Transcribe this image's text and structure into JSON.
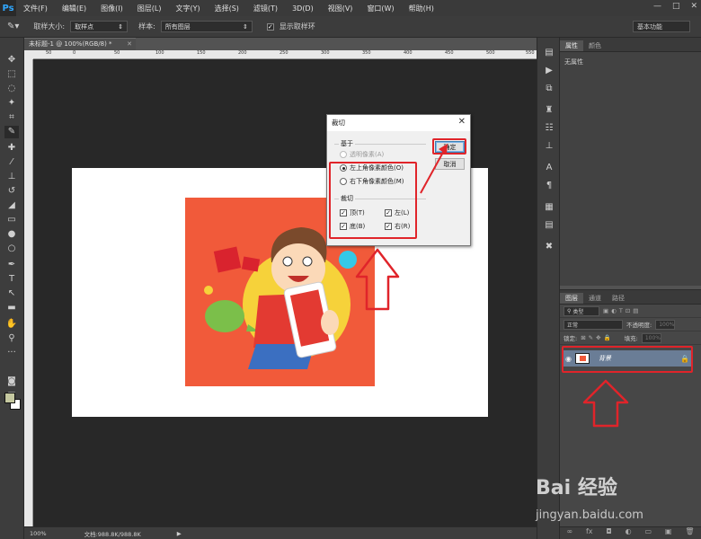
{
  "app": {
    "logo": "Ps",
    "menu": [
      "文件(F)",
      "编辑(E)",
      "图像(I)",
      "图层(L)",
      "文字(Y)",
      "选择(S)",
      "滤镜(T)",
      "3D(D)",
      "视图(V)",
      "窗口(W)",
      "帮助(H)"
    ],
    "window_controls": [
      "—",
      "□",
      "✕"
    ]
  },
  "options_bar": {
    "sample_size_label": "取样大小:",
    "sample_size_value": "取样点",
    "sample_label": "样本:",
    "sample_value": "所有图层",
    "show_ring_label": "显示取样环",
    "workspace": "基本功能"
  },
  "document": {
    "tab_title": "未标题-1 @ 100%(RGB/8) *",
    "ruler_top": [
      "50",
      "0",
      "50",
      "100",
      "150",
      "200",
      "250",
      "300",
      "350",
      "400",
      "450",
      "500",
      "550"
    ],
    "status_zoom": "100%",
    "status_doc": "文档:988.8K/988.8K"
  },
  "dialog": {
    "title": "裁切",
    "based_on_label": "基于",
    "opt_transparent": "透明像素(A)",
    "opt_top_left": "左上角像素颜色(O)",
    "opt_bottom_right": "右下角像素颜色(M)",
    "trim_label": "裁切",
    "chk_top": "顶(T)",
    "chk_left": "左(L)",
    "chk_bottom": "底(B)",
    "chk_right": "右(R)",
    "ok_button": "确定",
    "cancel_button": "取消"
  },
  "properties_panel": {
    "tabs": [
      "属性",
      "颜色"
    ],
    "content": "无属性"
  },
  "layers_panel": {
    "tabs": [
      "图层",
      "通道",
      "路径"
    ],
    "filter_kind": "类型",
    "blend_mode": "正常",
    "opacity_label": "不透明度:",
    "opacity_value": "100%",
    "lock_label": "锁定:",
    "fill_label": "填充:",
    "fill_value": "100%",
    "layer_name": "背景"
  },
  "watermark": {
    "logo": "Bai 经验",
    "url": "jingyan.baidu.com"
  },
  "colors": {
    "illustration_bg": "#f15a3a",
    "annotation_red": "#e0242a"
  }
}
